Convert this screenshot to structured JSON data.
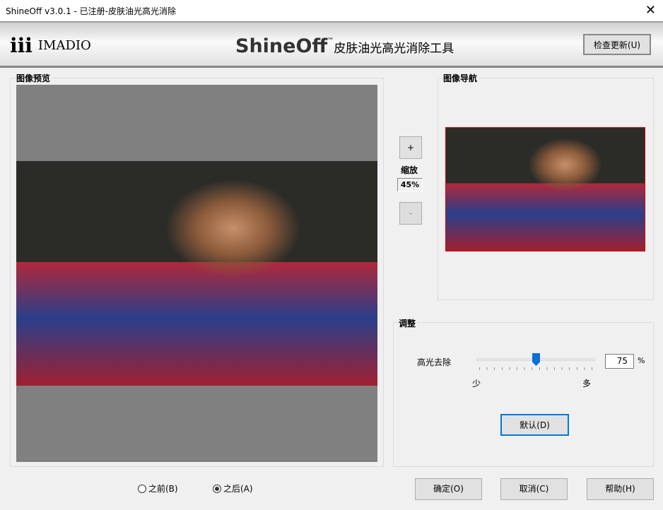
{
  "window": {
    "title": "ShineOff v3.0.1 - 已注册-皮肤油光高光消除"
  },
  "banner": {
    "logo_mark": "iii",
    "logo_text": "IMADIO",
    "app_name": "ShineOff",
    "tm": "™",
    "subtitle": "皮肤油光高光消除工具",
    "update_button": "检查更新(U)"
  },
  "preview": {
    "label": "图像预览"
  },
  "navigator": {
    "label": "图像导航"
  },
  "zoom": {
    "plus": "+",
    "minus": "-",
    "label": "缩放",
    "value": "45%"
  },
  "adjust": {
    "label": "调整",
    "slider_label": "高光去除",
    "value": "75",
    "unit": "%",
    "min_label": "少",
    "max_label": "多",
    "default_button": "默认(D)"
  },
  "view": {
    "before": "之前(B)",
    "after": "之后(A)",
    "selected": "after"
  },
  "buttons": {
    "ok": "确定(O)",
    "cancel": "取消(C)",
    "help": "帮助(H)"
  }
}
